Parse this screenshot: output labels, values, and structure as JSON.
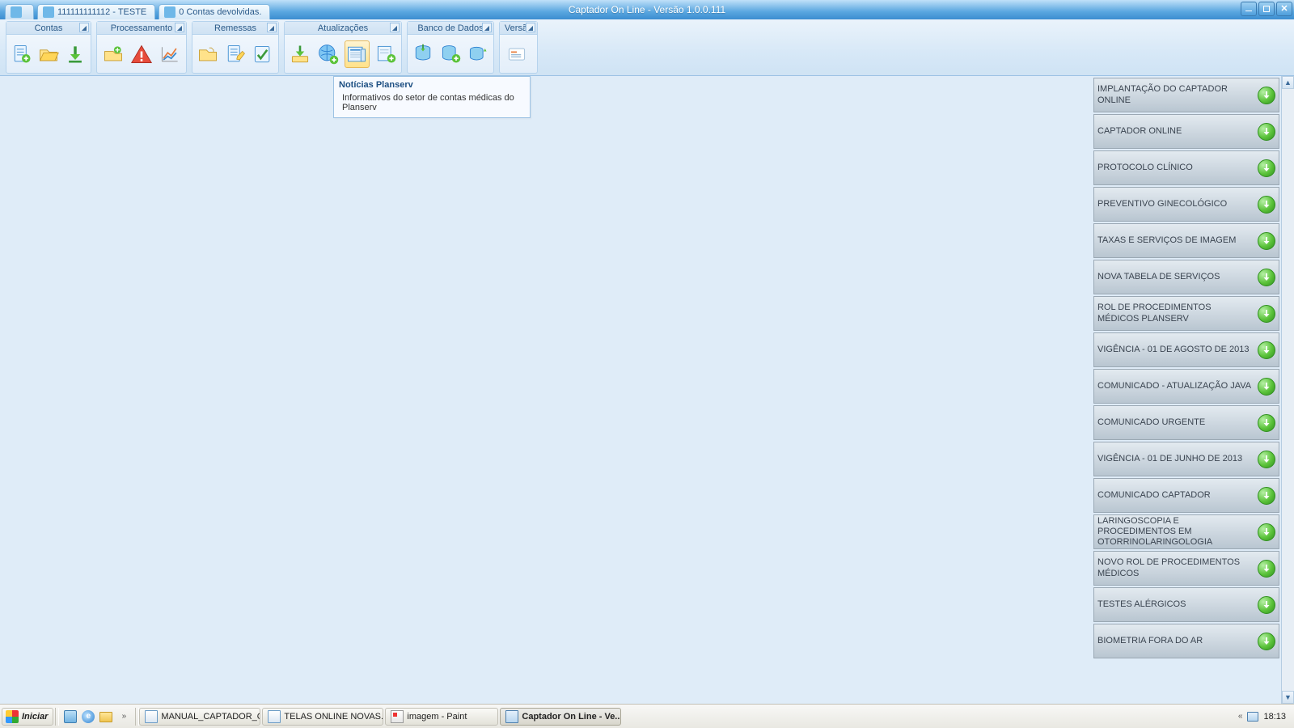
{
  "titlebar": {
    "tab_app": "",
    "tab1": "111111111112 - TESTE",
    "tab2": "0 Contas devolvidas.",
    "title": "Captador On Line - Versão 1.0.0.111"
  },
  "ribbon": {
    "groups": [
      {
        "label": "Contas"
      },
      {
        "label": "Processamento"
      },
      {
        "label": "Remessas"
      },
      {
        "label": "Atualizações"
      },
      {
        "label": "Banco de Dados"
      },
      {
        "label": "Versão"
      }
    ]
  },
  "tooltip": {
    "title": "Notícias Planserv",
    "desc": "Informativos do setor de contas médicas do Planserv"
  },
  "news": [
    "IMPLANTAÇÃO DO CAPTADOR ONLINE",
    "CAPTADOR ONLINE",
    "PROTOCOLO CLÍNICO",
    "PREVENTIVO GINECOLÓGICO",
    "TAXAS E SERVIÇOS DE IMAGEM",
    "NOVA TABELA DE SERVIÇOS",
    "ROL DE PROCEDIMENTOS MÉDICOS PLANSERV",
    "VIGÊNCIA - 01 DE AGOSTO DE 2013",
    "COMUNICADO - ATUALIZAÇÃO JAVA",
    "COMUNICADO URGENTE",
    "VIGÊNCIA - 01 DE JUNHO DE 2013",
    "COMUNICADO CAPTADOR",
    "LARINGOSCOPIA E PROCEDIMENTOS EM OTORRINOLARINGOLOGIA",
    "NOVO ROL DE PROCEDIMENTOS MÉDICOS",
    "TESTES ALÉRGICOS",
    "BIOMETRIA FORA DO AR"
  ],
  "taskbar": {
    "start": "Iniciar",
    "tasks": [
      "MANUAL_CAPTADOR_O...",
      "TELAS ONLINE NOVAS.d...",
      "imagem - Paint",
      "Captador On Line - Ve..."
    ],
    "clock": "18:13"
  }
}
